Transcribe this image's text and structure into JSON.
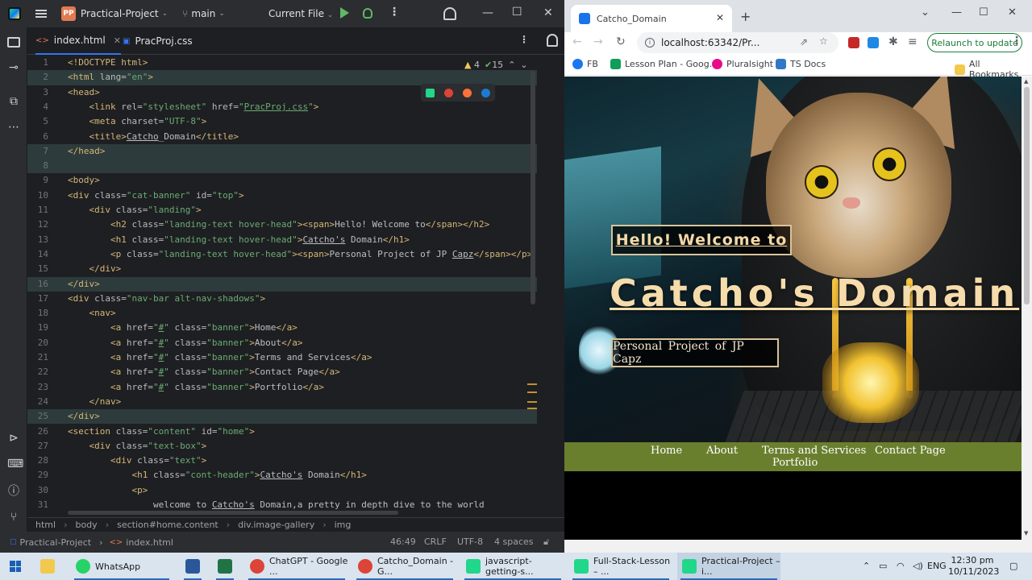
{
  "ide": {
    "project_badge": "PP",
    "project_name": "Practical-Project",
    "branch": "main",
    "run_config": "Current File",
    "tabs": [
      {
        "label": "index.html",
        "icon": "<>"
      },
      {
        "label": "PracProj.css",
        "icon": "css-file-icon"
      }
    ],
    "inspections": {
      "warnings": "4",
      "ok": "15"
    },
    "lines": [
      {
        "n": "1",
        "html": "<span class='t'>&lt;!DOCTYPE html&gt;</span>"
      },
      {
        "n": "2",
        "html": "<span class='t'>&lt;html </span><span class='a'>lang=</span><span class='v'>\"en\"</span><span class='t'>&gt;</span>"
      },
      {
        "n": "3",
        "html": "<span class='t'>&lt;head&gt;</span>"
      },
      {
        "n": "4",
        "html": "    <span class='t'>&lt;link </span><span class='a'>rel=</span><span class='v'>\"stylesheet\"</span><span class='a'> href=</span><span class='v'>\"<span class='u'>PracProj.css</span>\"</span><span class='t'>&gt;</span>"
      },
      {
        "n": "5",
        "html": "    <span class='t'>&lt;meta </span><span class='a'>charset=</span><span class='v'>\"UTF-8\"</span><span class='t'>&gt;</span>"
      },
      {
        "n": "6",
        "html": "    <span class='t'>&lt;title&gt;</span><span class='u'>Catcho</span>_Domain<span class='t'>&lt;/title&gt;</span>"
      },
      {
        "n": "7",
        "html": "<span class='t'>&lt;/head&gt;</span>"
      },
      {
        "n": "8",
        "html": ""
      },
      {
        "n": "9",
        "html": "<span class='t'>&lt;body&gt;</span>"
      },
      {
        "n": "10",
        "html": "<span class='t'>&lt;div </span><span class='a'>class=</span><span class='v'>\"cat-banner\"</span><span class='a'> id=</span><span class='v'>\"top\"</span><span class='t'>&gt;</span>"
      },
      {
        "n": "11",
        "html": "    <span class='t'>&lt;div </span><span class='a'>class=</span><span class='v'>\"landing\"</span><span class='t'>&gt;</span>"
      },
      {
        "n": "12",
        "html": "        <span class='t'>&lt;h2 </span><span class='a'>class=</span><span class='v'>\"landing-text hover-head\"</span><span class='t'>&gt;&lt;span&gt;</span>Hello! Welcome to<span class='t'>&lt;/span&gt;&lt;/h2&gt;</span>"
      },
      {
        "n": "13",
        "html": "        <span class='t'>&lt;h1 </span><span class='a'>class=</span><span class='v'>\"landing-text hover-head\"</span><span class='t'>&gt;</span><span class='u'>Catcho's</span> Domain<span class='t'>&lt;/h1&gt;</span>"
      },
      {
        "n": "14",
        "html": "        <span class='t'>&lt;p </span><span class='a'>class=</span><span class='v'>\"landing-text hover-head\"</span><span class='t'>&gt;&lt;span&gt;</span>Personal Project of JP <span class='u'>Capz</span><span class='t'>&lt;/span&gt;&lt;/p&gt;</span>"
      },
      {
        "n": "15",
        "html": "    <span class='t'>&lt;/div&gt;</span>"
      },
      {
        "n": "16",
        "html": "<span class='t'>&lt;/div&gt;</span>"
      },
      {
        "n": "17",
        "html": "<span class='t'>&lt;div </span><span class='a'>class=</span><span class='v'>\"nav-bar alt-nav-shadows\"</span><span class='t'>&gt;</span>"
      },
      {
        "n": "18",
        "html": "    <span class='t'>&lt;nav&gt;</span>"
      },
      {
        "n": "19",
        "html": "        <span class='t'>&lt;a </span><span class='a'>href=</span><span class='v'>\"<span class='u'>#</span>\"</span><span class='a'> class=</span><span class='v'>\"banner\"</span><span class='t'>&gt;</span>Home<span class='t'>&lt;/a&gt;</span>"
      },
      {
        "n": "20",
        "html": "        <span class='t'>&lt;a </span><span class='a'>href=</span><span class='v'>\"<span class='u'>#</span>\"</span><span class='a'> class=</span><span class='v'>\"banner\"</span><span class='t'>&gt;</span>About<span class='t'>&lt;/a&gt;</span>"
      },
      {
        "n": "21",
        "html": "        <span class='t'>&lt;a </span><span class='a'>href=</span><span class='v'>\"<span class='u'>#</span>\"</span><span class='a'> class=</span><span class='v'>\"banner\"</span><span class='t'>&gt;</span>Terms and Services<span class='t'>&lt;/a&gt;</span>"
      },
      {
        "n": "22",
        "html": "        <span class='t'>&lt;a </span><span class='a'>href=</span><span class='v'>\"<span class='u'>#</span>\"</span><span class='a'> class=</span><span class='v'>\"banner\"</span><span class='t'>&gt;</span>Contact Page<span class='t'>&lt;/a&gt;</span>"
      },
      {
        "n": "23",
        "html": "        <span class='t'>&lt;a </span><span class='a'>href=</span><span class='v'>\"<span class='u'>#</span>\"</span><span class='a'> class=</span><span class='v'>\"banner\"</span><span class='t'>&gt;</span>Portfolio<span class='t'>&lt;/a&gt;</span>"
      },
      {
        "n": "24",
        "html": "    <span class='t'>&lt;/nav&gt;</span>"
      },
      {
        "n": "25",
        "html": "<span class='t'>&lt;/div&gt;</span>"
      },
      {
        "n": "26",
        "html": "<span class='t'>&lt;section </span><span class='a'>class=</span><span class='v'>\"content\"</span><span class='a'> id=</span><span class='v'>\"home\"</span><span class='t'>&gt;</span>"
      },
      {
        "n": "27",
        "html": "    <span class='t'>&lt;div </span><span class='a'>class=</span><span class='v'>\"text-box\"</span><span class='t'>&gt;</span>"
      },
      {
        "n": "28",
        "html": "        <span class='t'>&lt;div </span><span class='a'>class=</span><span class='v'>\"text\"</span><span class='t'>&gt;</span>"
      },
      {
        "n": "29",
        "html": "            <span class='t'>&lt;h1 </span><span class='a'>class=</span><span class='v'>\"cont-header\"</span><span class='t'>&gt;</span><span class='u'>Catcho's</span> Domain<span class='t'>&lt;/h1&gt;</span>"
      },
      {
        "n": "30",
        "html": "            <span class='t'>&lt;p&gt;</span>"
      },
      {
        "n": "31",
        "html": "                welcome to <span class='u'>Catcho's</span> Domain,a pretty in depth dive to the world"
      }
    ],
    "highlighted_lines": [
      "2",
      "7",
      "8",
      "16",
      "25"
    ],
    "breadcrumb": [
      "html",
      "body",
      "section#home.content",
      "div.image-gallery",
      "img"
    ],
    "status": {
      "project": "Practical-Project",
      "file": "index.html",
      "position": "46:49",
      "line_sep": "CRLF",
      "encoding": "UTF-8",
      "indent": "4 spaces"
    }
  },
  "browser": {
    "tab_title": "Catcho_Domain",
    "url": "localhost:63342/Pr...",
    "relaunch_label": "Relaunch to update",
    "bookmarks": [
      {
        "label": "FB",
        "color": "#1877f2"
      },
      {
        "label": "Lesson Plan - Goog...",
        "color": "#0f9d58"
      },
      {
        "label": "Pluralsight",
        "color": "#e80a89"
      },
      {
        "label": "TS Docs",
        "color": "#3178c6"
      }
    ],
    "all_bookmarks": "All Bookmarks",
    "page": {
      "hello": "Hello! Welcome to",
      "title": "Catcho's Domain",
      "subtitle": "Personal Project of JP Capz",
      "nav": [
        "Home",
        "About",
        "Terms and Services",
        "Contact Page",
        "Portfolio"
      ],
      "nav_color": "#6a7f2e",
      "text_color": "#f3d9a6"
    }
  },
  "taskbar": {
    "items": [
      {
        "label": "WhatsApp",
        "color": "#25d366"
      },
      {
        "label": "",
        "color": "#2b579a"
      },
      {
        "label": "",
        "color": "#217346"
      },
      {
        "label": "ChatGPT - Google ...",
        "color": "#db4437"
      },
      {
        "label": "Catcho_Domain - G...",
        "color": "#db4437"
      },
      {
        "label": "javascript-getting-s...",
        "color": "#21d789"
      },
      {
        "label": "Full-Stack-Lesson – ...",
        "color": "#21d789"
      },
      {
        "label": "Practical-Project – i...",
        "color": "#21d789"
      }
    ],
    "lang": "ENG",
    "time": "12:30 pm",
    "date": "10/11/2023"
  }
}
